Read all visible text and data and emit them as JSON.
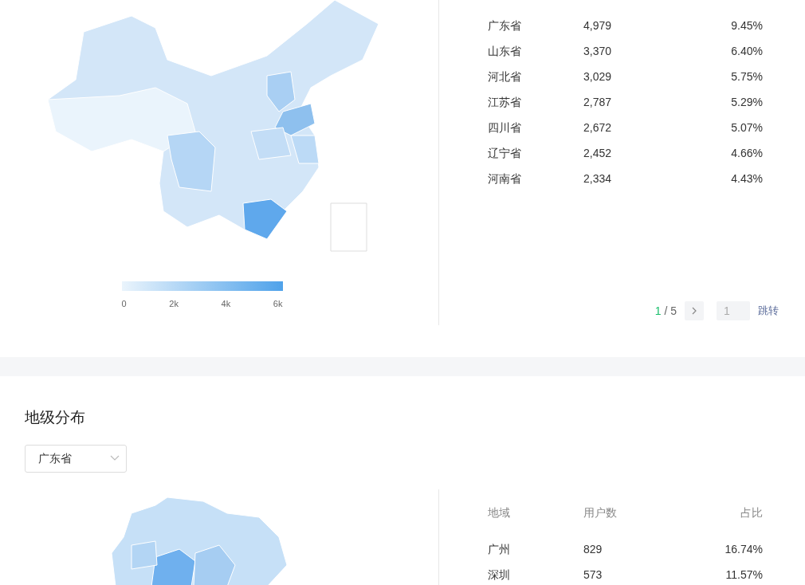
{
  "province_section": {
    "legend": {
      "labels": [
        "0",
        "2k",
        "4k",
        "6k"
      ]
    },
    "rows": [
      {
        "region": "广东省",
        "users": "4,979",
        "share": "9.45%"
      },
      {
        "region": "山东省",
        "users": "3,370",
        "share": "6.40%"
      },
      {
        "region": "河北省",
        "users": "3,029",
        "share": "5.75%"
      },
      {
        "region": "江苏省",
        "users": "2,787",
        "share": "5.29%"
      },
      {
        "region": "四川省",
        "users": "2,672",
        "share": "5.07%"
      },
      {
        "region": "辽宁省",
        "users": "2,452",
        "share": "4.66%"
      },
      {
        "region": "河南省",
        "users": "2,334",
        "share": "4.43%"
      }
    ],
    "pager": {
      "current": "1",
      "total": "/ 5",
      "jump_value": "1",
      "jump_label": "跳转"
    }
  },
  "city_section": {
    "title": "地级分布",
    "select": {
      "value": "广东省"
    },
    "columns": [
      "地域",
      "用户数",
      "占比"
    ],
    "rows": [
      {
        "region": "广州",
        "users": "829",
        "share": "16.74%"
      },
      {
        "region": "深圳",
        "users": "573",
        "share": "11.57%"
      }
    ]
  }
}
